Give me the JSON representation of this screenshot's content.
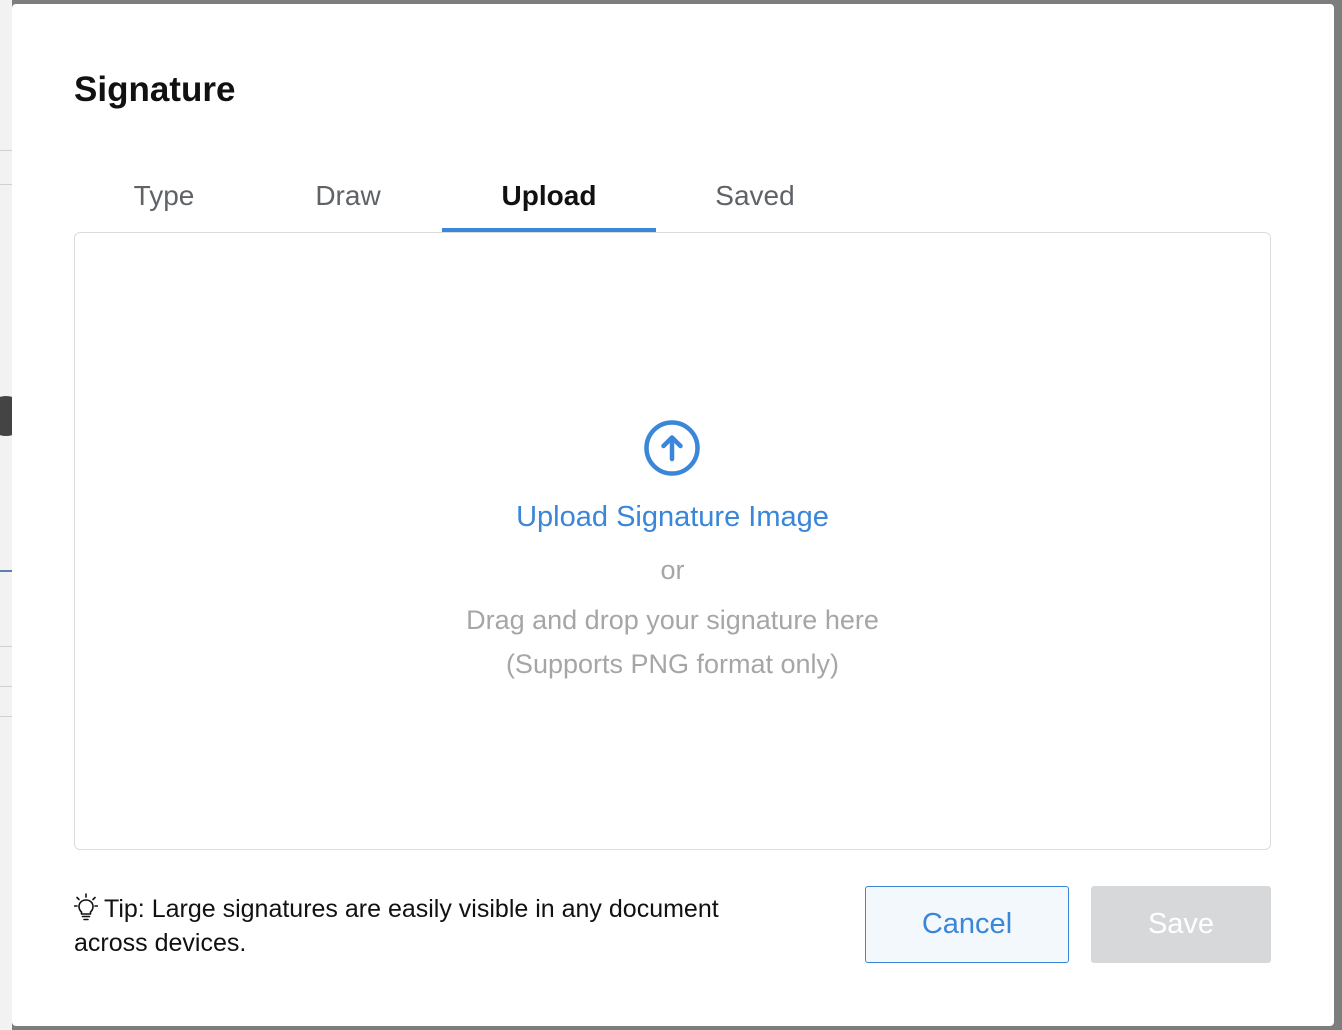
{
  "dialog": {
    "title": "Signature"
  },
  "tabs": [
    {
      "label": "Type",
      "active": false
    },
    {
      "label": "Draw",
      "active": false
    },
    {
      "label": "Upload",
      "active": true
    },
    {
      "label": "Saved",
      "active": false
    }
  ],
  "upload": {
    "icon": "upload-arrow-circle-icon",
    "link_label": "Upload Signature Image",
    "or_label": "or",
    "drag_text": "Drag and drop your signature here",
    "formats_text": "(Supports PNG format only)"
  },
  "footer": {
    "tip_icon": "lightbulb-icon",
    "tip_text": "Tip: Large signatures are easily visible in any document across devices.",
    "cancel_label": "Cancel",
    "save_label": "Save"
  },
  "colors": {
    "accent": "#3a86d8",
    "muted_text": "#a6a6a6",
    "disabled_button": "#d7d8da"
  }
}
